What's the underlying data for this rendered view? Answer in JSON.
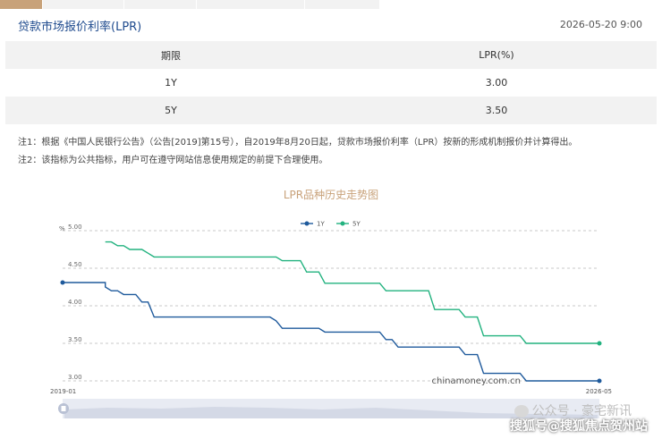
{
  "header": {
    "title": "贷款市场报价利率(LPR)",
    "timestamp": "2026-05-20 9:00"
  },
  "table": {
    "headers": [
      "期限",
      "LPR(%)"
    ],
    "rows": [
      [
        "1Y",
        "3.00"
      ],
      [
        "5Y",
        "3.50"
      ]
    ]
  },
  "notes": [
    "注1：根据《中国人民银行公告》（公告[2019]第15号），自2019年8月20日起，贷款市场报价利率（LPR）按新的形成机制报价并计算得出。",
    "注2：该指标为公共指标，用户可在遵守网站信息使用规定的前提下合理使用。"
  ],
  "watermarks": {
    "credit": "chinamoney.com.cn",
    "wechat": "公众号 · 豪宅新讯",
    "sohu": "搜狐号@搜狐焦点贺州站"
  },
  "colors": {
    "accent": "#c8a27a",
    "title": "#1f4b8e",
    "series_1y": "#1f5a9c",
    "series_5y": "#22b27f"
  },
  "chart_data": {
    "type": "line",
    "title": "LPR品种历史走势图",
    "ylabel": "%",
    "ylim": [
      3.0,
      5.0
    ],
    "yticks": [
      "5.00",
      "4.50",
      "4.00",
      "3.50",
      "3.00"
    ],
    "xlim": [
      "2019-01",
      "2026-05"
    ],
    "xticks": [
      "2019-01",
      "2026-05"
    ],
    "legend_position": "top-center",
    "grid": "horizontal-dashed",
    "series": [
      {
        "name": "1Y",
        "color": "#1f5a9c",
        "points": [
          [
            "2019-01",
            4.31
          ],
          [
            "2019-08",
            4.31
          ],
          [
            "2019-08",
            4.25
          ],
          [
            "2019-09",
            4.2
          ],
          [
            "2019-10",
            4.2
          ],
          [
            "2019-11",
            4.15
          ],
          [
            "2020-01",
            4.15
          ],
          [
            "2020-02",
            4.05
          ],
          [
            "2020-03",
            4.05
          ],
          [
            "2020-04",
            3.85
          ],
          [
            "2021-11",
            3.85
          ],
          [
            "2021-12",
            3.8
          ],
          [
            "2022-01",
            3.7
          ],
          [
            "2022-07",
            3.7
          ],
          [
            "2022-08",
            3.65
          ],
          [
            "2023-05",
            3.65
          ],
          [
            "2023-06",
            3.55
          ],
          [
            "2023-07",
            3.55
          ],
          [
            "2023-08",
            3.45
          ],
          [
            "2024-06",
            3.45
          ],
          [
            "2024-07",
            3.35
          ],
          [
            "2024-09",
            3.35
          ],
          [
            "2024-10",
            3.1
          ],
          [
            "2025-04",
            3.1
          ],
          [
            "2025-05",
            3.0
          ],
          [
            "2026-05",
            3.0
          ]
        ]
      },
      {
        "name": "5Y",
        "color": "#22b27f",
        "points": [
          [
            "2019-08",
            4.85
          ],
          [
            "2019-09",
            4.85
          ],
          [
            "2019-10",
            4.8
          ],
          [
            "2019-11",
            4.8
          ],
          [
            "2019-12",
            4.75
          ],
          [
            "2020-01",
            4.75
          ],
          [
            "2020-02",
            4.75
          ],
          [
            "2020-03",
            4.7
          ],
          [
            "2020-04",
            4.65
          ],
          [
            "2021-12",
            4.65
          ],
          [
            "2022-01",
            4.6
          ],
          [
            "2022-04",
            4.6
          ],
          [
            "2022-05",
            4.45
          ],
          [
            "2022-06",
            4.45
          ],
          [
            "2022-07",
            4.45
          ],
          [
            "2022-08",
            4.3
          ],
          [
            "2023-05",
            4.3
          ],
          [
            "2023-06",
            4.2
          ],
          [
            "2024-01",
            4.2
          ],
          [
            "2024-02",
            3.95
          ],
          [
            "2024-06",
            3.95
          ],
          [
            "2024-07",
            3.85
          ],
          [
            "2024-09",
            3.85
          ],
          [
            "2024-10",
            3.6
          ],
          [
            "2025-04",
            3.6
          ],
          [
            "2025-05",
            3.5
          ],
          [
            "2026-05",
            3.5
          ]
        ]
      }
    ]
  }
}
